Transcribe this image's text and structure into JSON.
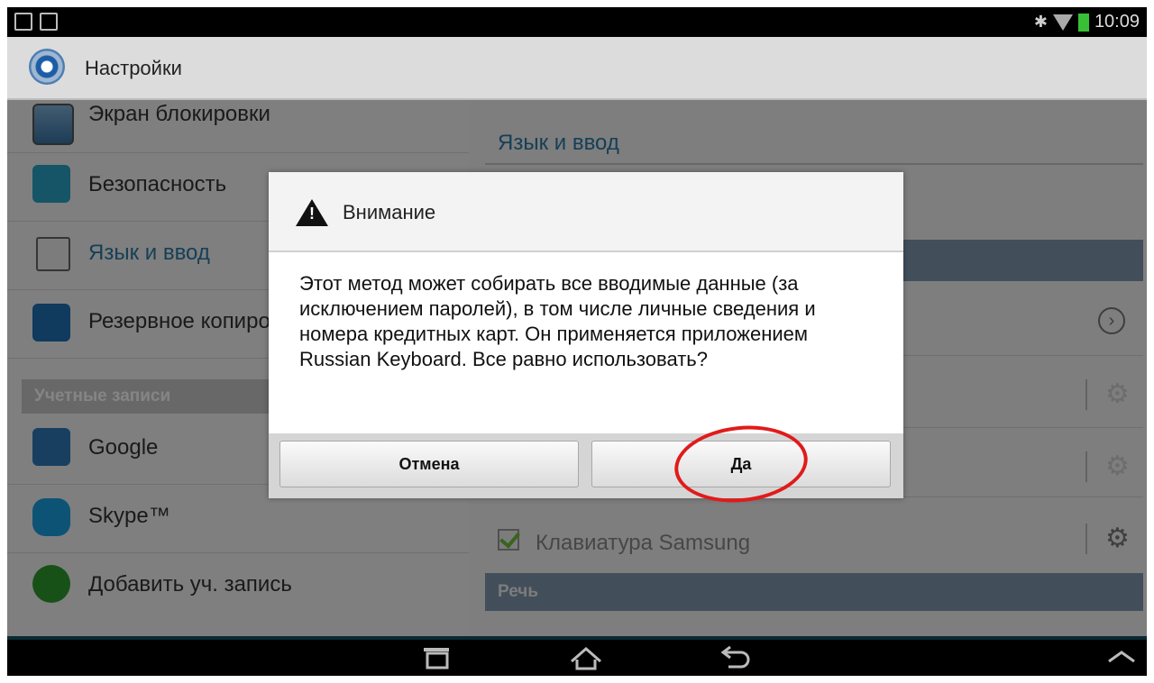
{
  "status_bar": {
    "time": "10:09",
    "icons": [
      "gallery-icon",
      "check-icon",
      "bluetooth-icon",
      "wifi-icon",
      "battery-icon"
    ],
    "battery_color": "#37c036"
  },
  "action_bar": {
    "title": "Настройки",
    "icon": "settings-app-icon"
  },
  "left_list": {
    "items": [
      {
        "label": "Экран блокировки",
        "icon": "lock-screen-icon"
      },
      {
        "label": "Безопасность",
        "icon": "security-lock-icon"
      },
      {
        "label": "Язык и ввод",
        "icon": "language-input-icon",
        "selected": true
      },
      {
        "label": "Резервное копирование",
        "icon": "backup-icon"
      }
    ],
    "section_accounts": "Учетные записи",
    "accounts": [
      {
        "label": "Google",
        "icon": "google-icon"
      },
      {
        "label": "Skype™",
        "icon": "skype-icon"
      },
      {
        "label": "Добавить уч. запись",
        "icon": "add-account-icon"
      }
    ]
  },
  "right_pane": {
    "title": "Язык и ввод",
    "samsung_keyboard": "Клавиатура Samsung",
    "section_speech": "Речь",
    "accent_color": "#2b7aa6"
  },
  "dialog": {
    "title": "Внимание",
    "message": "Этот метод может собирать все вводимые данные (за исключением паролей), в том числе личные сведения и номера кредитных карт. Он применяется приложением Russian Keyboard. Все равно использовать?",
    "cancel_label": "Отмена",
    "ok_label": "Да",
    "annotation_color": "#e01b1b"
  }
}
